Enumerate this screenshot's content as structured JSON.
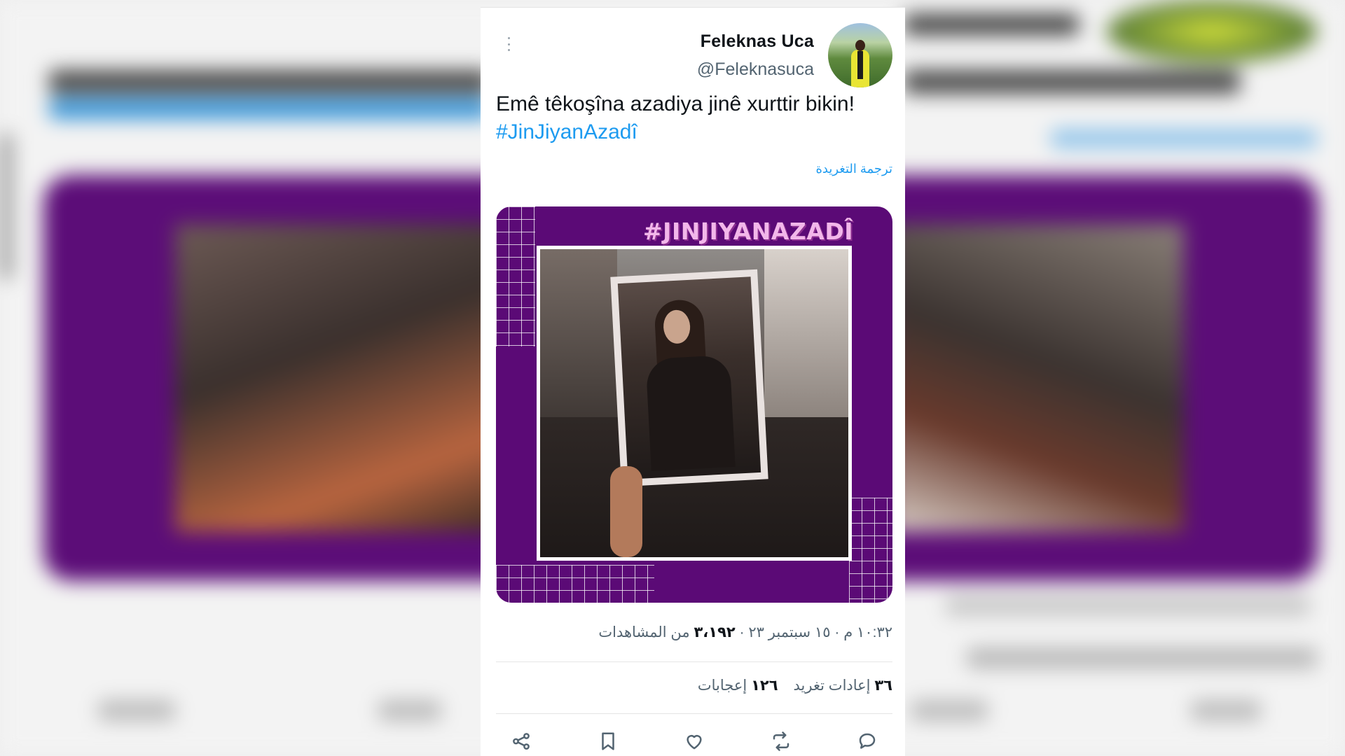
{
  "tweet": {
    "author_name": "Feleknas Uca",
    "author_handle": "@Feleknasuca",
    "text": "Emê têkoşîna azadiya jinê xurttir bikin!",
    "hashtag": "#JinJiyanAzadî",
    "translate_label": "ترجمة التغريدة",
    "media_hashtag": "#JINJIYANAZADÎ",
    "timestamp": "١٠:٣٢ م · ١٥ سبتمبر ٢٣ ·",
    "views_count": "٣،١٩٢",
    "views_label": "من المشاهدات",
    "retweets_count": "٣٦",
    "retweets_label": "إعادات تغريد",
    "likes_count": "١٢٦",
    "likes_label": "إعجابات"
  },
  "actions": [
    "reply-icon",
    "retweet-icon",
    "like-icon",
    "bookmark-icon",
    "share-icon"
  ],
  "colors": {
    "accent": "#1d9bf0",
    "media_bg": "#5b0a76",
    "text": "#0f1419",
    "muted": "#536471"
  }
}
